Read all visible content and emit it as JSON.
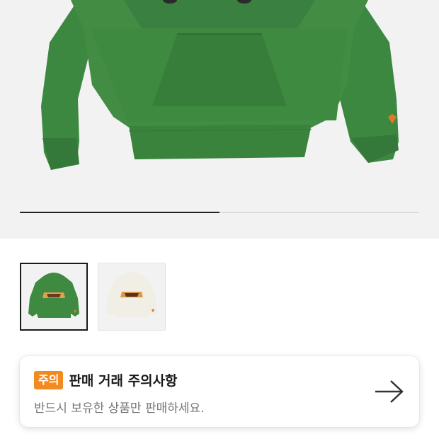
{
  "gallery": {
    "progress": 0.5,
    "colors": {
      "hoodie_green": "#3f8a41",
      "hoodie_cream": "#f1eee5",
      "accent_orange": "#e0782a"
    }
  },
  "thumbnails": [
    {
      "name": "green-hoodie-thumbnail",
      "selected": true
    },
    {
      "name": "cream-hoodie-thumbnail",
      "selected": false
    }
  ],
  "notice": {
    "badge": "주의",
    "title": "판매 거래 주의사항",
    "subtitle": "반드시 보유한 상품만 판매하세요.",
    "icon": "arrow-right-icon",
    "badge_color": "#f38a1f"
  }
}
